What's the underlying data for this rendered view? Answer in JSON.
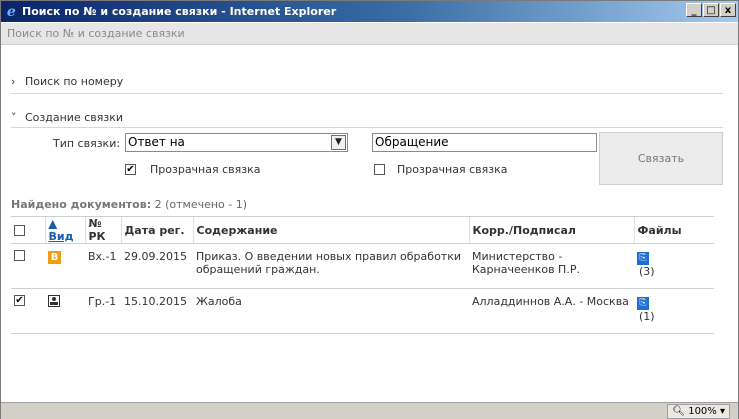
{
  "window": {
    "title": "Поиск по № и создание связки - Internet Explorer",
    "min_label": "_",
    "max_label": "□",
    "close_label": "x"
  },
  "page": {
    "header": "Поиск по № и создание связки"
  },
  "sections": {
    "search_by_number": {
      "chevron": "›",
      "label": "Поиск по номеру"
    },
    "create_link": {
      "chevron": "˅",
      "label": "Создание связки"
    }
  },
  "link_form": {
    "type_label": "Тип связки:",
    "type_value": "Ответ на",
    "target_value": "Обращение",
    "transparent_left": {
      "label": "Прозрачная связка",
      "checked": true,
      "mark": "✔"
    },
    "transparent_right": {
      "label": "Прозрачная связка",
      "checked": false,
      "mark": ""
    },
    "link_button": "Связать"
  },
  "found": {
    "label": "Найдено документов:",
    "summary": "2 (отмечено - 1)"
  },
  "table": {
    "headers": {
      "kind": "▲ Вид",
      "rk": "№ РК",
      "date": "Дата рег.",
      "content": "Содержание",
      "corr": "Корр./Подписал",
      "files": "Файлы"
    },
    "rows": [
      {
        "checked": false,
        "mark": "",
        "kind_icon": "b-icon",
        "kind_letter": "B",
        "rk": "Вх.-1",
        "date": "29.09.2015",
        "content": "Приказ. О введении новых правил обработки обращений граждан.",
        "corr": "Министерство - Карначеенков П.Р.",
        "files_icon": "paperclip-icon",
        "files_count": "(3)"
      },
      {
        "checked": true,
        "mark": "✔",
        "kind_icon": "person-icon",
        "kind_letter": "",
        "rk": "Гр.-1",
        "date": "15.10.2015",
        "content": "Жалоба",
        "corr": "Алладдиннов А.А. - Москва",
        "files_icon": "paperclip-icon",
        "files_count": "(1)"
      }
    ]
  },
  "statusbar": {
    "zoom": "100%"
  },
  "colors": {
    "titlebar_start": "#0a246a",
    "titlebar_end": "#a6caf0",
    "link": "#1a5ea8",
    "clip": "#1e6fd0",
    "badge": "#f39c12"
  }
}
